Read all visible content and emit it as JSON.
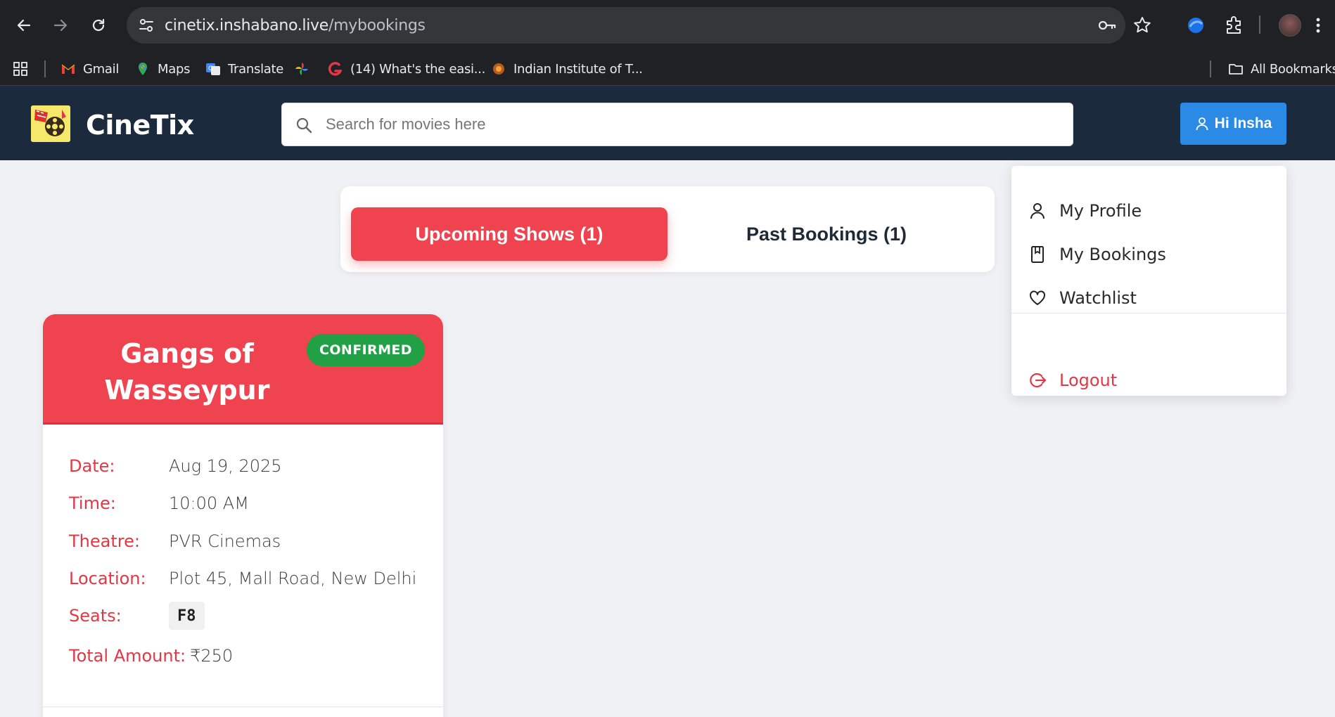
{
  "browser": {
    "url_host": "cinetix.inshabano.live",
    "url_path": "/mybookings",
    "bookmarks": [
      {
        "label": "Gmail",
        "icon": "gmail-icon"
      },
      {
        "label": "Maps",
        "icon": "maps-icon"
      },
      {
        "label": "Translate",
        "icon": "translate-icon"
      },
      {
        "label": "",
        "icon": "photos-icon"
      },
      {
        "label": "(14) What's the easi...",
        "icon": "site-icon"
      },
      {
        "label": "Indian Institute of T...",
        "icon": "institute-icon"
      }
    ],
    "all_bookmarks": "All Bookmarks"
  },
  "header": {
    "brand": "CineTix",
    "search_placeholder": "Search for movies here",
    "user_button": "Hi Insha"
  },
  "tabs": {
    "upcoming": "Upcoming Shows (1)",
    "past": "Past Bookings (1)"
  },
  "dropdown": {
    "items": [
      "My Profile",
      "My Bookings",
      "Watchlist"
    ],
    "logout": "Logout"
  },
  "booking": {
    "title_line1": "Gangs of",
    "title_line2": "Wasseypur",
    "status": "CONFIRMED",
    "date_label": "Date:",
    "date": "Aug 19, 2025",
    "time_label": "Time:",
    "time": "10:00 AM",
    "theatre_label": "Theatre:",
    "theatre": "PVR Cinemas",
    "location_label": "Location:",
    "location": "Plot 45, Mall Road, New Delhi",
    "seats_label": "Seats:",
    "seat": "F8",
    "total_label": "Total Amount:",
    "total": "₹250"
  },
  "colors": {
    "header_bg": "#1b2a3c",
    "accent_red": "#ef434f",
    "user_button_blue": "#2b8ae6",
    "confirmed_green": "#22a045"
  }
}
